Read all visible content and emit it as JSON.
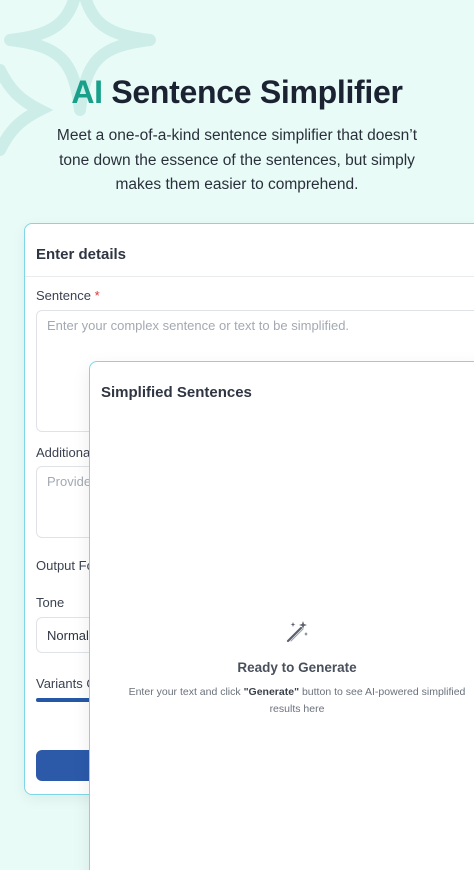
{
  "hero": {
    "title_accent": "AI",
    "title_rest": " Sentence Simplifier",
    "subtitle_line1": "Meet a one-of-a-kind sentence simplifier that doesn’t",
    "subtitle_line2": "tone down the essence of the sentences, but simply",
    "subtitle_line3": "makes them easier to comprehend.",
    "accent_color": "#19a08a"
  },
  "form": {
    "header": "Enter details",
    "sentence_label": "Sentence",
    "required_mark": "*",
    "sentence_placeholder": "Enter your complex sentence or text to be simplified.",
    "additional_label": "Additiona",
    "additional_placeholder": "Provide",
    "output_label": "Output Fo",
    "tone_label": "Tone",
    "tone_value": "Normal",
    "variants_label": "Variants G",
    "variants_fill_fraction": 0.18,
    "button_color": "#2c5aa9"
  },
  "result": {
    "header": "Simplified Sentences",
    "icon": "magic-wand-icon",
    "ready_title": "Ready to Generate",
    "hint_prefix": "Enter your text and click ",
    "hint_bold": "\"Generate\"",
    "hint_suffix": " button to see AI-powered simplified",
    "hint_line2": "results here"
  }
}
